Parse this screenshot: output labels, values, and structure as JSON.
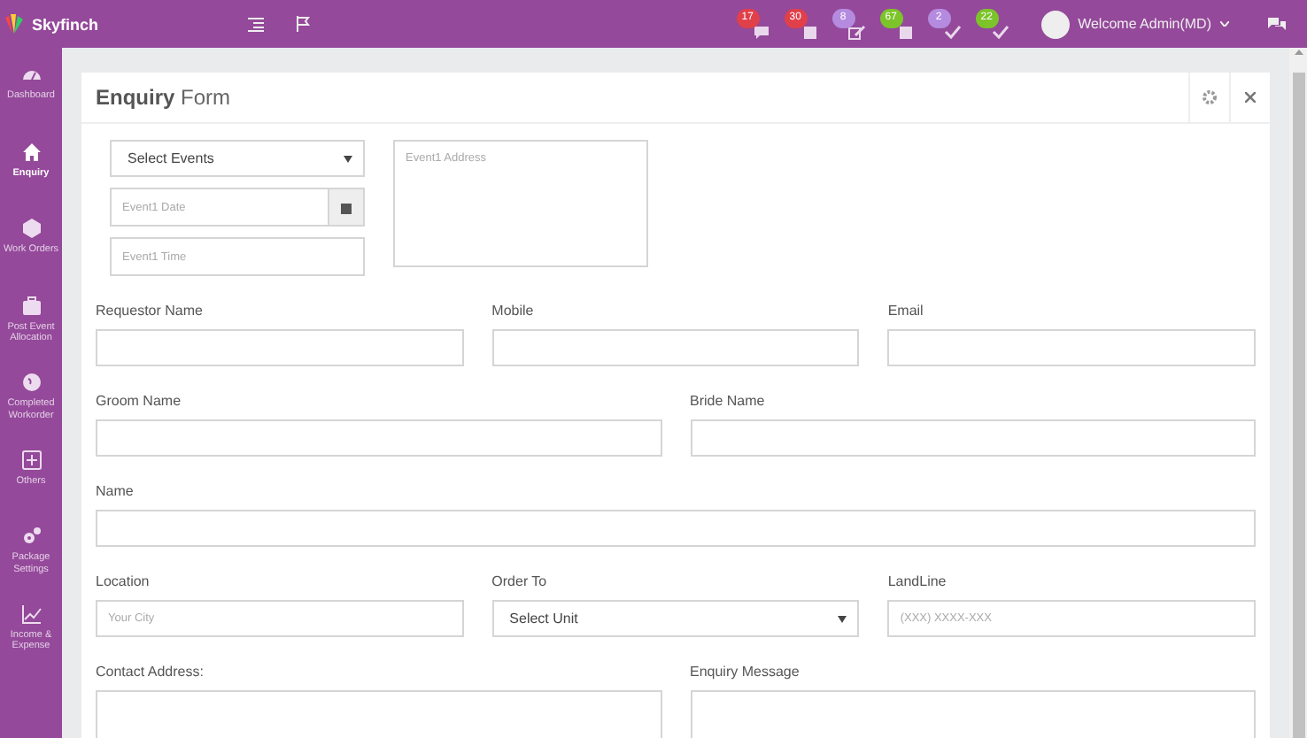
{
  "topbar": {
    "brand": "Skyfinch",
    "notifications": [
      {
        "count": "17",
        "color": "#e0404a",
        "kind": "comment"
      },
      {
        "count": "30",
        "color": "#e0404a",
        "kind": "doc"
      },
      {
        "count": "8",
        "color": "#b58be0",
        "kind": "edit"
      },
      {
        "count": "67",
        "color": "#7cc42a",
        "kind": "doc"
      },
      {
        "count": "2",
        "color": "#b58be0",
        "kind": "check"
      },
      {
        "count": "22",
        "color": "#7cc42a",
        "kind": "check"
      }
    ],
    "user": "Welcome Admin(MD)"
  },
  "sidebar": {
    "items": [
      {
        "label": "Dashboard",
        "selected": false
      },
      {
        "label": "Enquiry",
        "selected": true
      },
      {
        "label": "Work Orders",
        "selected": false
      },
      {
        "label": "Post Event Allocation",
        "selected": false
      },
      {
        "label": "Completed Workorder",
        "selected": false
      },
      {
        "label": "Others",
        "selected": false
      },
      {
        "label": "Package Settings",
        "selected": false
      },
      {
        "label": "Income & Expense",
        "selected": false
      }
    ]
  },
  "card": {
    "title_bold": "Enquiry",
    "title_rest": "Form",
    "events": {
      "select": "Select Events",
      "date_placeholder": "Event1 Date",
      "time_placeholder": "Event1 Time",
      "address_placeholder": "Event1 Address"
    },
    "rows": [
      [
        {
          "label": "Requestor Name",
          "kind": "text"
        },
        {
          "label": "Mobile",
          "kind": "text"
        },
        {
          "label": "Email",
          "kind": "text"
        }
      ],
      [
        {
          "label": "Groom Name",
          "kind": "text"
        },
        {
          "label": "Bride Name",
          "kind": "text"
        }
      ],
      [
        {
          "label": "Name",
          "kind": "text"
        }
      ],
      [
        {
          "label": "Location",
          "kind": "text",
          "placeholder": "Your City"
        },
        {
          "label": "Order To",
          "kind": "select",
          "value": "Select Unit"
        },
        {
          "label": "LandLine",
          "kind": "text",
          "placeholder": "(XXX) XXXX-XXX"
        }
      ],
      [
        {
          "label": "Contact Address:",
          "kind": "textarea"
        },
        {
          "label": "Enquiry Message",
          "kind": "textarea"
        }
      ]
    ]
  }
}
